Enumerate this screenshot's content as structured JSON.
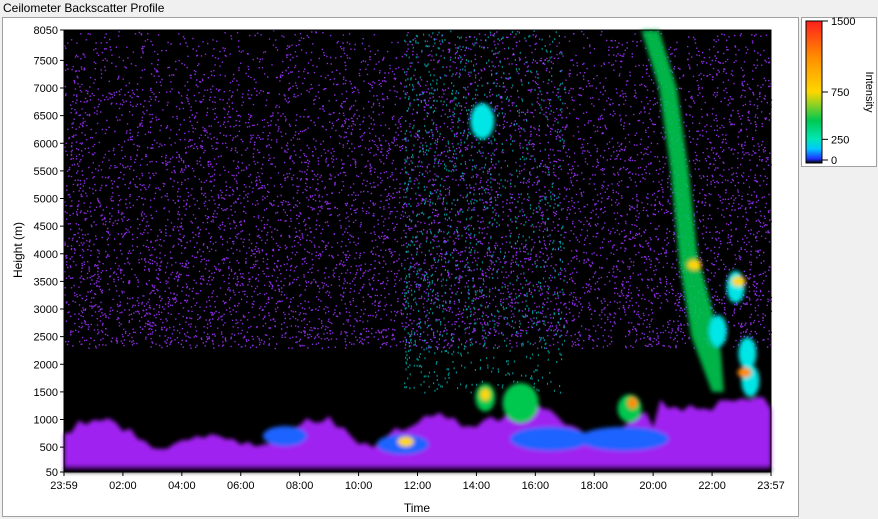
{
  "window": {
    "title": "Ceilometer Backscatter Profile"
  },
  "colors": {
    "background": "#000000",
    "noise": "#8a2be2",
    "low_cloud": "#a020f0",
    "mid": "#1e64ff",
    "cyan": "#00e6e6",
    "green": "#00c850",
    "yellow": "#ffd700",
    "orange": "#ff8c00",
    "red": "#ff1e1e"
  },
  "chart_data": {
    "type": "heatmap",
    "title": "Ceilometer Backscatter Profile",
    "xlabel": "Time",
    "ylabel": "Height (m)",
    "x_ticks": [
      "23:59",
      "02:00",
      "04:00",
      "06:00",
      "08:00",
      "10:00",
      "12:00",
      "14:00",
      "16:00",
      "18:00",
      "20:00",
      "22:00",
      "23:57"
    ],
    "y_ticks": [
      50,
      500,
      1000,
      1500,
      2000,
      2500,
      3000,
      3500,
      4000,
      4500,
      5000,
      5500,
      6000,
      6500,
      7000,
      7500,
      8050
    ],
    "ylim": [
      50,
      8050
    ],
    "colorbar": {
      "label": "Intensity",
      "ticks": [
        0,
        250,
        750,
        1500
      ],
      "range": [
        0,
        1500
      ]
    }
  }
}
